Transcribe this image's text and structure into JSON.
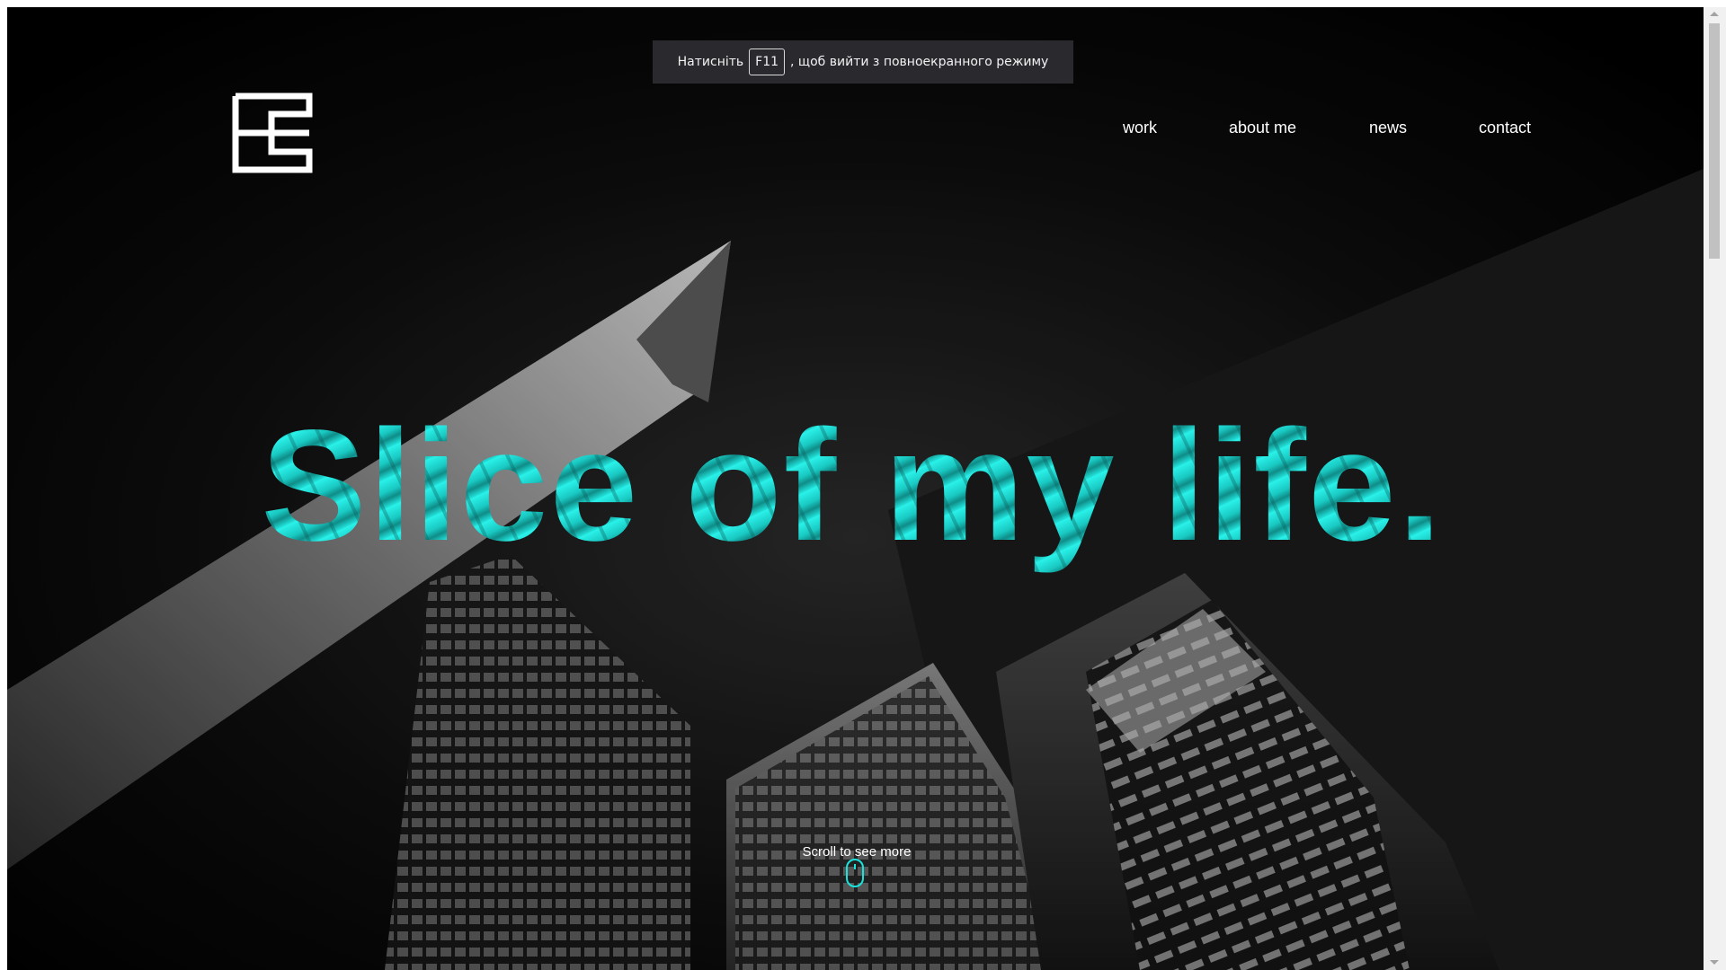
{
  "fullscreen_notice": {
    "prefix": "Натисніть",
    "key": "F11",
    "suffix": ", щоб вийти з повноекранного режиму"
  },
  "logo": {
    "icon": "monogram-logo-icon"
  },
  "nav": {
    "items": [
      {
        "label": "work"
      },
      {
        "label": "about me"
      },
      {
        "label": "news"
      },
      {
        "label": "contact"
      }
    ]
  },
  "hero": {
    "headline": "Slice of my life.",
    "scroll_hint": "Scroll to see more",
    "scroll_icon": "mouse-icon"
  },
  "colors": {
    "background": "#000000",
    "accent": "#19e3dc",
    "text": "#ffffff"
  }
}
